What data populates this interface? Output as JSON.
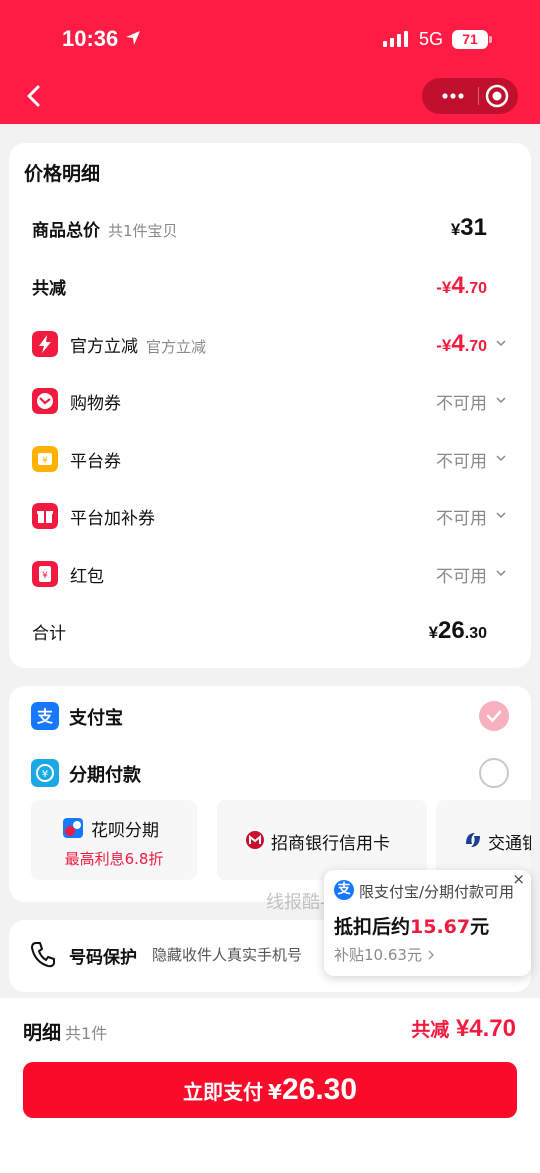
{
  "status_bar": {
    "time": "10:36",
    "network": "5G",
    "battery": "71"
  },
  "price_detail": {
    "title": "价格明细",
    "goods_total": {
      "label": "商品总价",
      "sub": "共1件宝贝",
      "yen": "¥",
      "value": "31"
    },
    "total_reduce": {
      "label": "共减",
      "sign": "-¥",
      "int": "4",
      "dec": ".70"
    },
    "official": {
      "label": "官方立减",
      "sub": "官方立减",
      "sign": "-¥",
      "int": "4",
      "dec": ".70"
    },
    "shopping_coupon": {
      "label": "购物券",
      "status": "不可用"
    },
    "platform_coupon": {
      "label": "平台券",
      "status": "不可用"
    },
    "platform_bonus_coupon": {
      "label": "平台加补券",
      "status": "不可用"
    },
    "red_packet": {
      "label": "红包",
      "status": "不可用"
    },
    "sum": {
      "label": "合计",
      "yen": "¥",
      "int": "26",
      "dec": ".30"
    }
  },
  "payment": {
    "alipay": {
      "label": "支付宝",
      "selected": true
    },
    "installment": {
      "label": "分期付款",
      "selected": false
    },
    "options": [
      {
        "name": "花呗分期",
        "sub": "最高利息6.8折"
      },
      {
        "name": "招商银行信用卡"
      },
      {
        "name": "交通银"
      }
    ]
  },
  "phone_protect": {
    "label": "号码保护",
    "desc": "隐藏收件人真实手机号"
  },
  "watermark": "线报酷-new.xianbao.fun",
  "popup": {
    "head": "限支付宝/分期付款可用",
    "main_prefix": "抵扣后约",
    "main_amount": "15.67",
    "main_suffix": "元",
    "sub": "补贴10.63元",
    "close": "×"
  },
  "bottom_bar": {
    "detail_label": "明细",
    "detail_count": "共1件",
    "reduce_label": "共减",
    "reduce_amount": "¥4.70",
    "pay_label": "立即支付",
    "pay_yen": "¥",
    "pay_amount": "26.30"
  },
  "colors": {
    "brand_red": "#fe1c44",
    "price_red": "#f21b3f",
    "pay_button": "#fa0b2a"
  }
}
